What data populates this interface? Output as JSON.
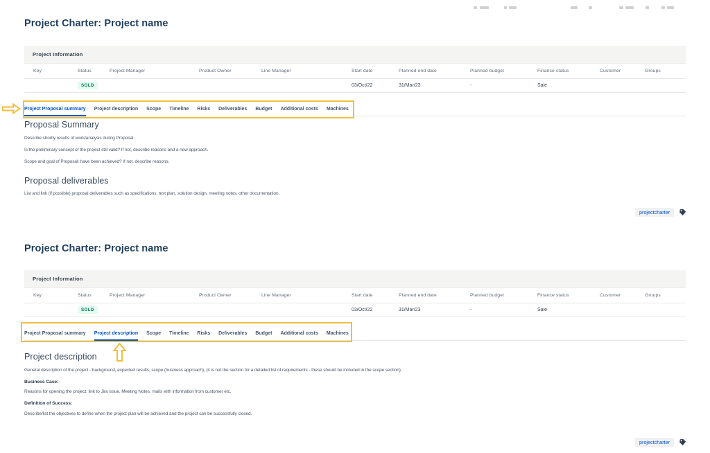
{
  "title": "Project Charter: Project name",
  "table": {
    "caption": "Project Information",
    "columns": [
      "Key",
      "Status",
      "Project Manager",
      "Product Owner",
      "Line Manager",
      "Start date",
      "Planned end date",
      "Planned budget",
      "Finance status",
      "Customer",
      "Groups"
    ],
    "row": {
      "key": "",
      "status_badge": "SOLD",
      "project_manager": "",
      "product_owner": "",
      "line_manager": "",
      "start_date": "03/Oct/22",
      "planned_end_date": "31/Mar/23",
      "planned_budget": "-",
      "finance_status": "Sale",
      "customer": "",
      "groups": ""
    },
    "status_color": "#00754f",
    "status_bg": "#e3fcef"
  },
  "tabs": [
    "Project Proposal summary",
    "Project description",
    "Scope",
    "Timeline",
    "Risks",
    "Deliverables",
    "Budget",
    "Additional costs",
    "Machines"
  ],
  "views": [
    {
      "active_tab": "Project Proposal summary",
      "heading1": "Proposal Summary",
      "paragraphs1": [
        "Describe shortly results of work/analysis during Proposal.",
        "Is the preliminary concept of the project still valid? If not, describe reasons and a new approach.",
        "Scope and goal of Proposal: have been achieved? If not, describe reasons."
      ],
      "heading2": "Proposal deliverables",
      "paragraph2": "List and link (if possible) proposal deliverables such as specifications, test plan, solution design, meeting notes, other documentation."
    },
    {
      "active_tab": "Project description",
      "heading": "Project description",
      "intro": "General description of the project - background, expected results, scope (business approach), (it is not the section for a detailed list of requirements - these should be included in the scope section).",
      "label1": "Business Case:",
      "para1": "Reasons for opening the project: link to Jira issue, Meeting Notes, mails with information from customer etc.",
      "label2": "Definition of Success:",
      "para2": "Describe/list the objectives to define when the project plan will be achieved and the project can be successfully closed."
    }
  ],
  "tag": {
    "label": "projectcharter"
  },
  "annotation": {
    "color": "#f0bf3e"
  },
  "accent": "#0052cc"
}
